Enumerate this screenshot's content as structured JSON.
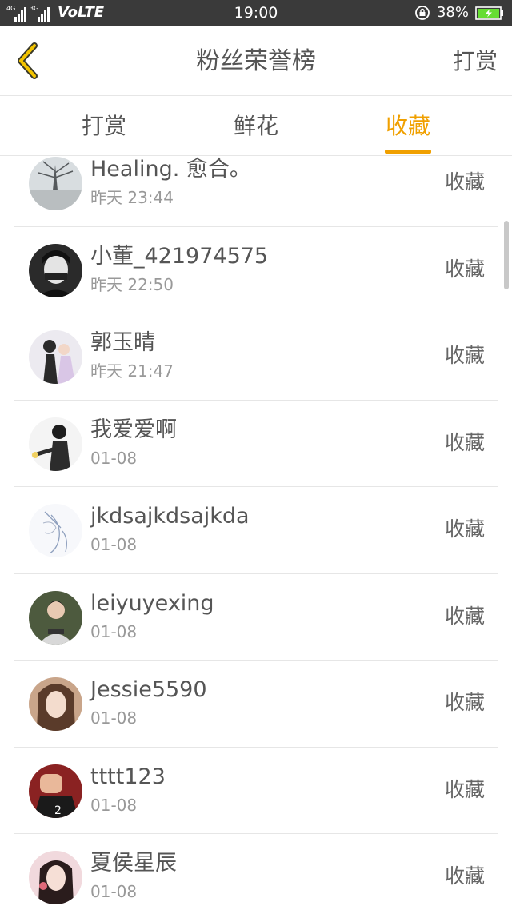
{
  "status_bar": {
    "net1": "4G",
    "net2": "3G",
    "volte": "VoLTE",
    "time": "19:00",
    "battery": "38%"
  },
  "header": {
    "title": "粉丝荣誉榜",
    "action": "打赏"
  },
  "tabs": [
    {
      "label": "打赏"
    },
    {
      "label": "鲜花"
    },
    {
      "label": "收藏"
    }
  ],
  "active_tab": "收藏",
  "colors": {
    "accent": "#f0a000",
    "status_bar": "#3a3a3a",
    "battery_fill": "#66dd33"
  },
  "list": [
    {
      "name": "Healing. 愈合。",
      "time": "昨天 23:44",
      "action": "收藏"
    },
    {
      "name": "小董_421974575",
      "time": "昨天 22:50",
      "action": "收藏"
    },
    {
      "name": "郭玉晴",
      "time": "昨天 21:47",
      "action": "收藏"
    },
    {
      "name": "我爱爱啊",
      "time": "01-08",
      "action": "收藏"
    },
    {
      "name": "jkdsajkdsajkda",
      "time": "01-08",
      "action": "收藏"
    },
    {
      "name": "leiyuyexing",
      "time": "01-08",
      "action": "收藏"
    },
    {
      "name": "Jessie5590",
      "time": "01-08",
      "action": "收藏"
    },
    {
      "name": "tttt123",
      "time": "01-08",
      "action": "收藏"
    },
    {
      "name": "夏侯星辰",
      "time": "01-08",
      "action": "收藏"
    }
  ]
}
